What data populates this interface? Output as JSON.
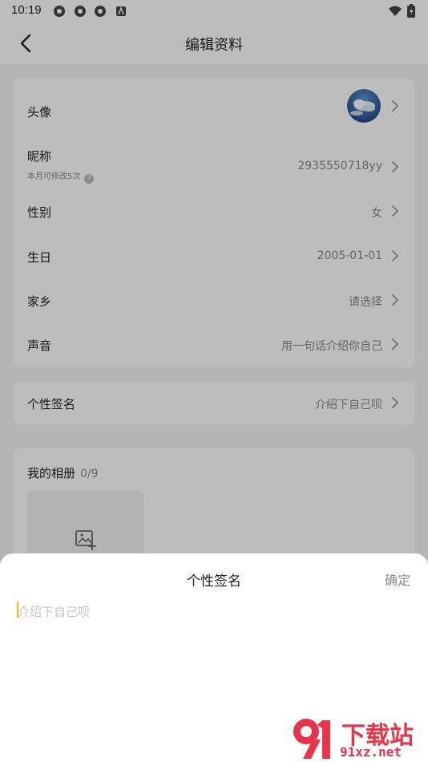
{
  "status": {
    "time": "10:19"
  },
  "header": {
    "title": "编辑资料"
  },
  "profile": {
    "avatar_label": "头像",
    "nickname_label": "昵称",
    "nickname_value": "2935550718yy",
    "nickname_hint": "本月可修改5次",
    "nickname_help": "?",
    "gender_label": "性别",
    "gender_value": "女",
    "birthday_label": "生日",
    "birthday_value": "2005-01-01",
    "hometown_label": "家乡",
    "hometown_value": "请选择",
    "voice_label": "声音",
    "voice_value": "用一句话介绍你自己"
  },
  "signature": {
    "label": "个性签名",
    "value": "介绍下自己呗"
  },
  "album": {
    "title": "我的相册",
    "count": "0/9"
  },
  "sheet": {
    "title": "个性签名",
    "confirm_label": "确定",
    "input_placeholder": "介绍下自己呗",
    "input_value": ""
  },
  "watermark": {
    "brand": "下载站",
    "url": "91xz.net"
  },
  "colors": {
    "overlay": "#000000",
    "caret": "#f2b800",
    "watermark": "#e8334a"
  }
}
